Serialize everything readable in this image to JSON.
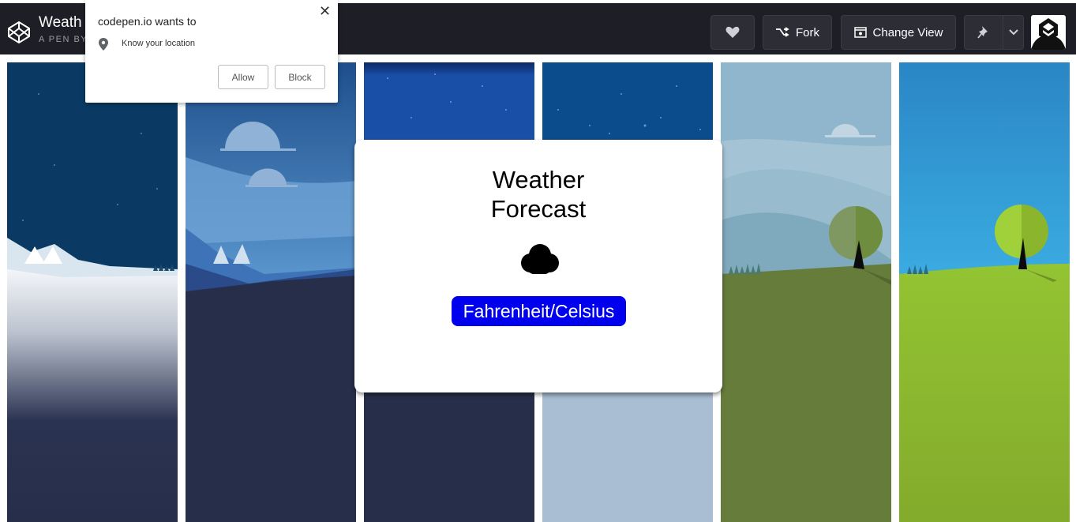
{
  "header": {
    "pen_title": "Weath",
    "pen_by": "A PEN BY",
    "buttons": {
      "heart_icon": "heart-icon",
      "fork_label": "Fork",
      "change_view_label": "Change View",
      "pin_icon": "pin-icon",
      "dropdown_icon": "chevron-down-icon"
    }
  },
  "popup": {
    "title": "codepen.io wants to",
    "close": "✕",
    "permission": "Know your location",
    "allow_label": "Allow",
    "block_label": "Block"
  },
  "card": {
    "title_line1": "Weather",
    "title_line2": "Forecast",
    "icon": "cloud-icon",
    "unit_button": "Fahrenheit/Celsius"
  },
  "colors": {
    "topbar": "#1e1f26",
    "unit_button_bg": "#0000ee",
    "unit_button_text": "#ffffff"
  }
}
